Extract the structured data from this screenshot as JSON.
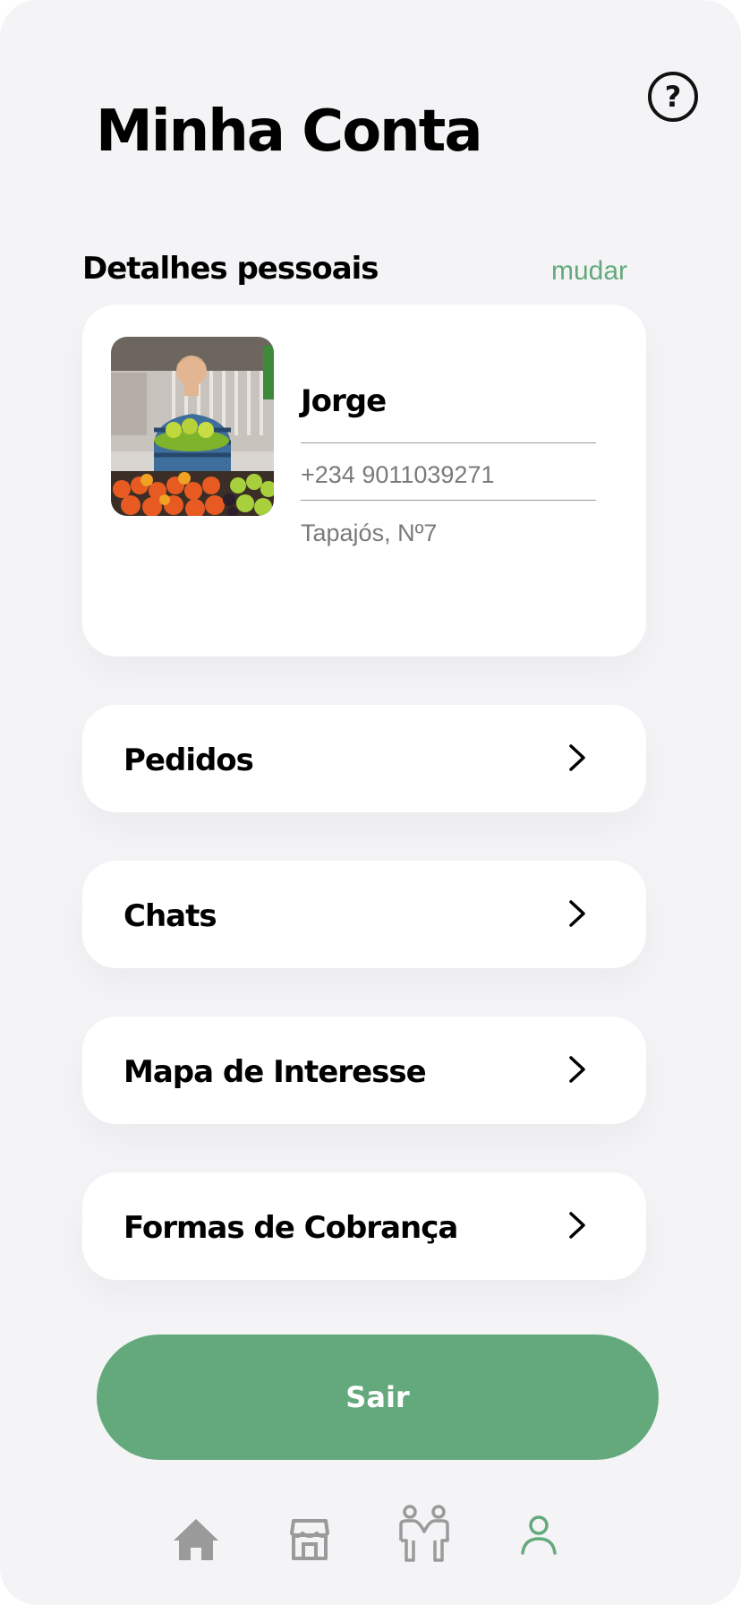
{
  "header": {
    "title": "Minha Conta",
    "help_icon": "help-circle-icon",
    "help_symbol": "?"
  },
  "personal": {
    "section_title": "Detalhes pessoais",
    "change_label": "mudar",
    "name": "Jorge",
    "phone": "+234 9011039271",
    "address": "Tapajós, Nº7"
  },
  "menu": {
    "items": [
      {
        "label": "Pedidos",
        "icon": "chevron-right-icon"
      },
      {
        "label": "Chats",
        "icon": "chevron-right-icon"
      },
      {
        "label": "Mapa de Interesse",
        "icon": "chevron-right-icon"
      },
      {
        "label": "Formas de Cobrança",
        "icon": "chevron-right-icon"
      }
    ]
  },
  "logout": {
    "label": "Sair"
  },
  "bottom_nav": {
    "items": [
      {
        "icon": "home-icon",
        "active": false
      },
      {
        "icon": "store-icon",
        "active": false
      },
      {
        "icon": "people-icon",
        "active": false
      },
      {
        "icon": "user-icon",
        "active": true
      }
    ],
    "active_color": "#64a97c",
    "inactive_color": "#9a9a9a"
  },
  "colors": {
    "accent": "#64a97c",
    "background": "#f4f4f6",
    "card": "#ffffff"
  }
}
